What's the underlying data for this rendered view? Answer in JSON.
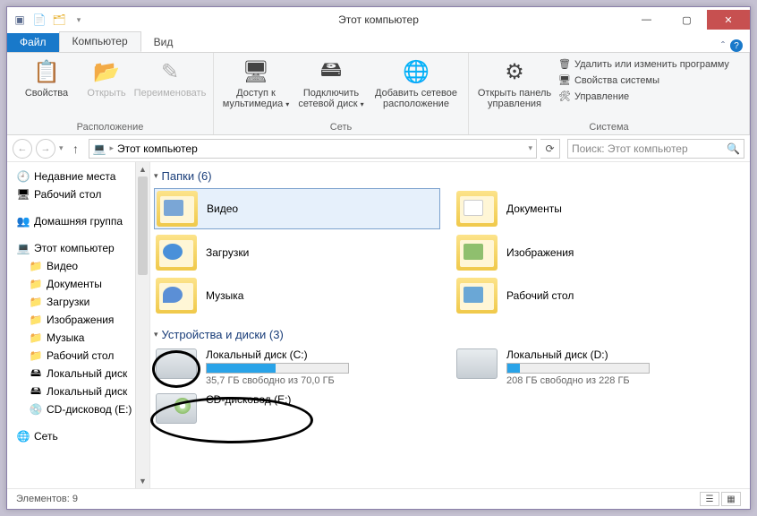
{
  "title": "Этот компьютер",
  "tabs": {
    "file": "Файл",
    "computer": "Компьютер",
    "view": "Вид"
  },
  "ribbon": {
    "location": {
      "label": "Расположение",
      "props": "Свойства",
      "open": "Открыть",
      "rename": "Переименовать"
    },
    "network": {
      "label": "Сеть",
      "media": "Доступ к мультимедиа",
      "mapdrive": "Подключить сетевой диск",
      "addnet": "Добавить сетевое расположение"
    },
    "system": {
      "label": "Система",
      "panel": "Открыть панель управления",
      "uninstall": "Удалить или изменить программу",
      "sysprops": "Свойства системы",
      "manage": "Управление"
    }
  },
  "breadcrumb": {
    "root": "Этот компьютер"
  },
  "search": {
    "placeholder": "Поиск: Этот компьютер"
  },
  "nav": {
    "recent": "Недавние места",
    "desktop": "Рабочий стол",
    "homegroup": "Домашняя группа",
    "thispc": "Этот компьютер",
    "video": "Видео",
    "documents": "Документы",
    "downloads": "Загрузки",
    "pictures": "Изображения",
    "music": "Музыка",
    "desk2": "Рабочий стол",
    "diskc": "Локальный диск",
    "diskd": "Локальный диск",
    "cd": "CD-дисковод (E:)",
    "network": "Сеть"
  },
  "sections": {
    "folders": "Папки (6)",
    "drives": "Устройства и диски (3)"
  },
  "folders": [
    {
      "name": "Видео"
    },
    {
      "name": "Документы"
    },
    {
      "name": "Загрузки"
    },
    {
      "name": "Изображения"
    },
    {
      "name": "Музыка"
    },
    {
      "name": "Рабочий стол"
    }
  ],
  "drives": [
    {
      "name": "Локальный диск (C:)",
      "sub": "35,7 ГБ свободно из 70,0 ГБ",
      "fill": 49
    },
    {
      "name": "Локальный диск (D:)",
      "sub": "208 ГБ свободно из 228 ГБ",
      "fill": 9
    },
    {
      "name": "CD-дисковод (E:)",
      "sub": "",
      "fill": null
    }
  ],
  "status": {
    "count": "Элементов: 9"
  }
}
